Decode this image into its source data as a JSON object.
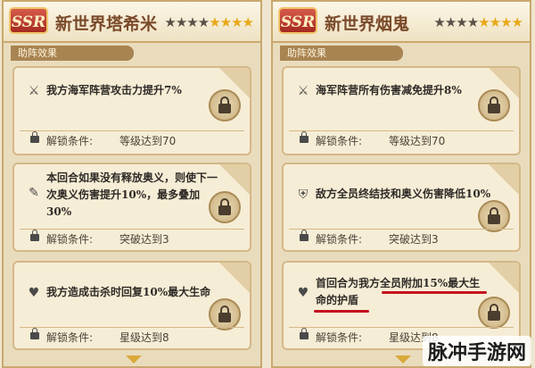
{
  "left": {
    "rarity": "SSR",
    "name": "新世界塔希米",
    "stars": {
      "dark": "★★★★",
      "gold": "★★★★"
    },
    "section": "助阵效果",
    "cards": [
      {
        "effect": "我方海军阵营攻击力提升7%",
        "cond_key": "解锁条件:",
        "cond_val": "等级达到70"
      },
      {
        "effect": "本回合如果没有释放奥义，则使下一次奥义伤害提升10%，最多叠加30%",
        "cond_key": "解锁条件:",
        "cond_val": "突破达到3"
      },
      {
        "effect": "我方造成击杀时回复10%最大生命",
        "cond_key": "解锁条件:",
        "cond_val": "星级达到8"
      }
    ]
  },
  "right": {
    "rarity": "SSR",
    "name": "新世界烟鬼",
    "stars": {
      "dark": "★★★★",
      "gold": "★★★★"
    },
    "section": "助阵效果",
    "cards": [
      {
        "effect": "海军阵营所有伤害减免提升8%",
        "cond_key": "解锁条件:",
        "cond_val": "等级达到70"
      },
      {
        "effect": "敌方全员终结技和奥义伤害降低10%",
        "cond_key": "解锁条件:",
        "cond_val": "突破达到3"
      },
      {
        "effect": "首回合为我方全员附加15%最大生命的护盾",
        "cond_key": "解锁条件:",
        "cond_val": "星级达到8"
      }
    ]
  },
  "watermark": "脉冲手游网",
  "colors": {
    "accent_red": "#c4121e",
    "star_gold": "#e8a818",
    "panel_bg": "#e9dcbd"
  }
}
